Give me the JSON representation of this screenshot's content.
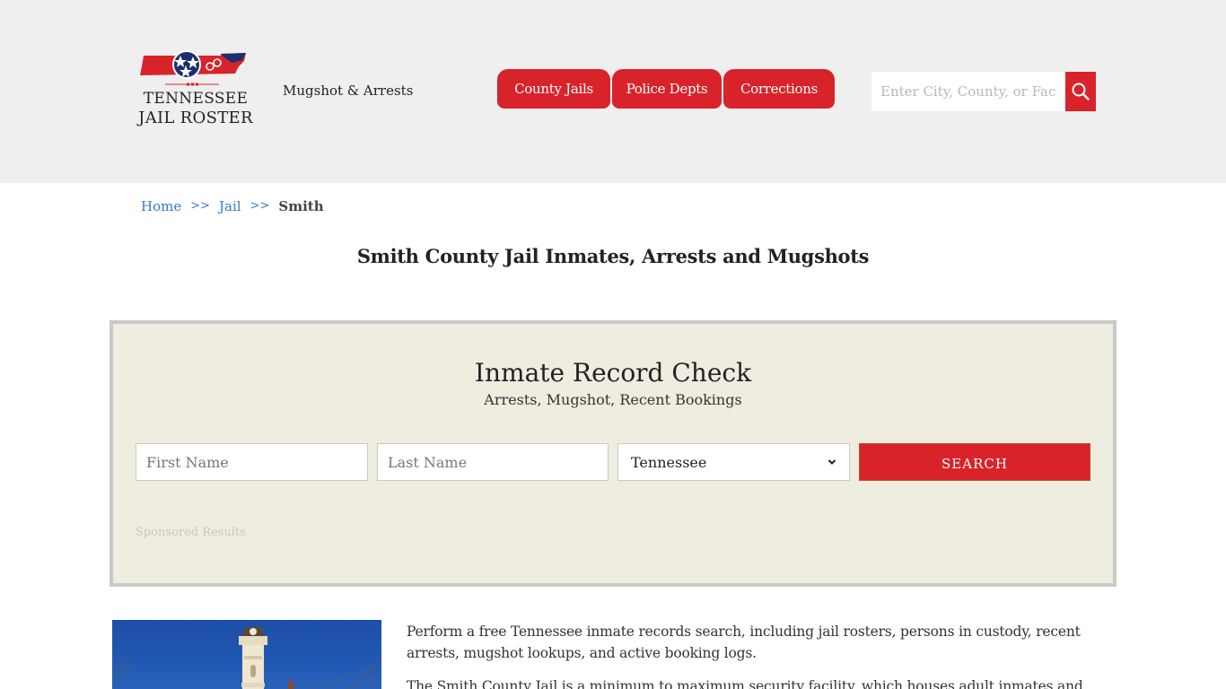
{
  "header": {
    "logo": {
      "line1": "TENNESSEE",
      "line2": "JAIL ROSTER"
    },
    "tagline": "Mugshot & Arrests",
    "nav": [
      {
        "label": "County Jails"
      },
      {
        "label": "Police Depts"
      },
      {
        "label": "Corrections"
      }
    ],
    "search": {
      "placeholder": "Enter City, County, or Facility",
      "button_icon": "search-icon"
    }
  },
  "breadcrumb": {
    "items": [
      {
        "label": "Home"
      },
      {
        "label": "Jail"
      }
    ],
    "separator": ">>",
    "current": "Smith"
  },
  "page_title": "Smith County Jail Inmates, Arrests and Mugshots",
  "record_check": {
    "title": "Inmate Record Check",
    "subtitle": "Arrests, Mugshot, Recent Bookings",
    "first_name_placeholder": "First Name",
    "last_name_placeholder": "Last Name",
    "state_selected": "Tennessee",
    "search_label": "SEARCH",
    "sponsored": "Sponsored Results"
  },
  "content": {
    "paragraphs": [
      "Perform a free Tennessee inmate records search, including jail rosters, persons in custody, recent arrests, mugshot lookups, and active booking logs.",
      "The Smith County Jail is a minimum to maximum security facility, which houses adult inmates and"
    ]
  },
  "colors": {
    "brand_red": "#d8232a",
    "header_bg": "#efefef",
    "record_box_bg": "#efede0",
    "link_blue": "#3a78c8"
  }
}
